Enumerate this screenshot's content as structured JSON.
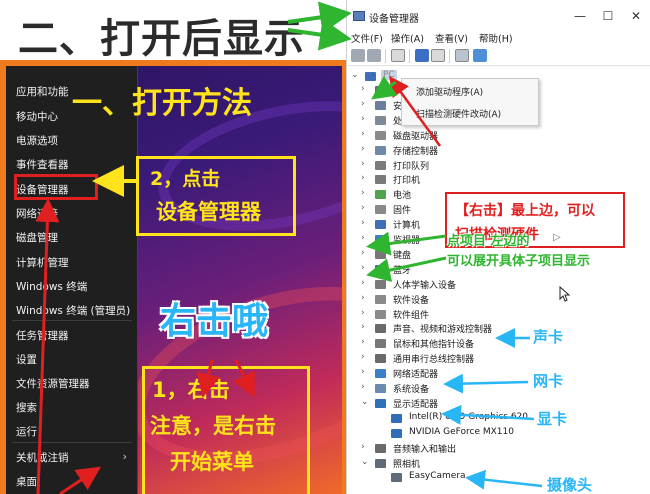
{
  "heading": {
    "text": "二、打开后显示"
  },
  "winx_menu": {
    "items": [
      {
        "label": "应用和功能"
      },
      {
        "label": "移动中心"
      },
      {
        "label": "电源选项"
      },
      {
        "label": "事件查看器"
      },
      {
        "label": "设备管理器"
      },
      {
        "label": "网络连接"
      },
      {
        "label": "磁盘管理"
      },
      {
        "label": "计算机管理"
      },
      {
        "label": "Windows 终端"
      },
      {
        "label": "Windows 终端 (管理员)"
      },
      {
        "label": "任务管理器"
      },
      {
        "label": "设置"
      },
      {
        "label": "文件资源管理器"
      },
      {
        "label": "搜索"
      },
      {
        "label": "运行"
      },
      {
        "label": "关机或注销"
      },
      {
        "label": "桌面"
      }
    ],
    "chevron": "›"
  },
  "annotations_left": {
    "step1_title": "一、打开方法",
    "step2_line1": "2，点击",
    "step2_line2": "设备管理器",
    "right_click": "右击哦",
    "step1_line1": "1，右击",
    "step1_line2": "注意，是右击",
    "step1_line3": "开始菜单"
  },
  "device_manager": {
    "title": "设备管理器",
    "window_controls": {
      "minimize": "—",
      "maximize": "☐",
      "close": "✕"
    },
    "menu": [
      "文件(F)",
      "操作(A)",
      "查看(V)",
      "帮助(H)"
    ],
    "root_label": "PC",
    "context_menu": [
      "添加驱动程序(A)",
      "扫描检测硬件改动(A)"
    ],
    "tree": [
      {
        "label": "",
        "icon": "camera-icon"
      },
      {
        "label": "安全设备",
        "icon": "security-icon"
      },
      {
        "label": "处理器",
        "icon": "cpu-icon"
      },
      {
        "label": "磁盘驱动器",
        "icon": "disk-icon"
      },
      {
        "label": "存储控制器",
        "icon": "storage-icon"
      },
      {
        "label": "打印队列",
        "icon": "printer-icon"
      },
      {
        "label": "打印机",
        "icon": "printer-icon"
      },
      {
        "label": "电池",
        "icon": "battery-icon"
      },
      {
        "label": "固件",
        "icon": "firmware-icon"
      },
      {
        "label": "计算机",
        "icon": "computer-icon"
      },
      {
        "label": "监视器",
        "icon": "monitor-icon"
      },
      {
        "label": "键盘",
        "icon": "keyboard-icon"
      },
      {
        "label": "蓝牙",
        "icon": "bluetooth-icon"
      },
      {
        "label": "人体学输入设备",
        "icon": "hid-icon"
      },
      {
        "label": "软件设备",
        "icon": "software-icon"
      },
      {
        "label": "软件组件",
        "icon": "component-icon"
      },
      {
        "label": "声音、视频和游戏控制器",
        "icon": "sound-icon"
      },
      {
        "label": "鼠标和其他指针设备",
        "icon": "mouse-icon"
      },
      {
        "label": "通用串行总线控制器",
        "icon": "usb-icon"
      },
      {
        "label": "网络适配器",
        "icon": "network-icon"
      },
      {
        "label": "系统设备",
        "icon": "system-icon"
      },
      {
        "label": "显示适配器",
        "icon": "display-icon"
      },
      {
        "label": "Intel(R) UHD Graphics 620",
        "icon": "display-icon",
        "child": true
      },
      {
        "label": "NVIDIA GeForce MX110",
        "icon": "display-icon",
        "child": true
      },
      {
        "label": "音频输入和输出",
        "icon": "audio-icon"
      },
      {
        "label": "照相机",
        "icon": "camera-icon"
      },
      {
        "label": "EasyCamera",
        "icon": "camera-icon",
        "child": true
      }
    ]
  },
  "annotations_right": {
    "red_box_line1": "【右击】最上边，可以",
    "red_box_line2": "扫描检测硬件",
    "green_line1": "点项目 左边的",
    "green_line2": "可以展开具体子项目显示",
    "sound_card": "声卡",
    "network_card": "网卡",
    "display_card": "显卡",
    "camera": "摄像头"
  },
  "colors": {
    "orange_frame": "#f07a1e",
    "menu_bg": "#1f1f1f",
    "highlight_red": "#e02020",
    "annotation_yellow": "#ffe41c",
    "annotation_blue": "#29b6f6",
    "annotation_green": "#2fb52f"
  }
}
